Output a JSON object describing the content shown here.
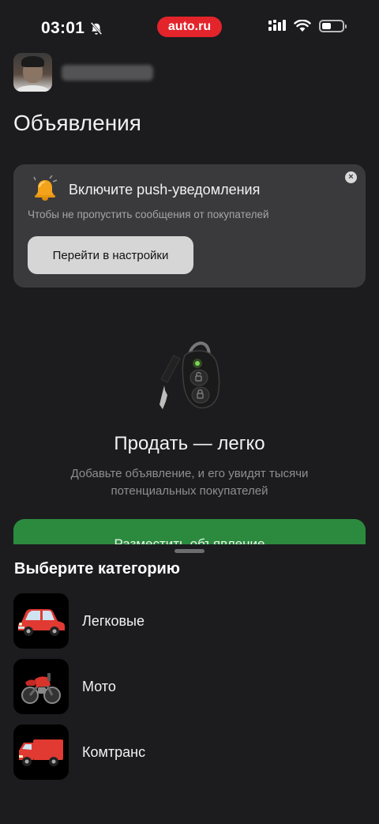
{
  "status_bar": {
    "time": "03:01",
    "brand": "auto.ru",
    "battery_level": 0.4
  },
  "icons": {
    "status": [
      "bell-slash-icon",
      "signal-icon",
      "wifi-icon",
      "battery-icon"
    ],
    "push": [
      "bell-icon",
      "close-icon"
    ]
  },
  "header": {
    "title": "Объявления"
  },
  "push_card": {
    "title": "Включите push-уведомления",
    "subtitle": "Чтобы не пропустить сообщения от покупателей",
    "button_label": "Перейти в настройки"
  },
  "empty_state": {
    "title": "Продать — легко",
    "description": "Добавьте объявление, и его увидят тысячи потенциальных покупателей",
    "button_label": "Разместить объявление"
  },
  "sheet": {
    "title": "Выберите категорию",
    "categories": [
      {
        "label": "Легковые",
        "icon": "car-icon"
      },
      {
        "label": "Мото",
        "icon": "motorcycle-icon"
      },
      {
        "label": "Комтранс",
        "icon": "truck-icon"
      }
    ]
  },
  "colors": {
    "brand": "#e3242b",
    "accent_green": "#2c8a3f",
    "background": "#1c1c1e",
    "card": "#3a3a3c"
  }
}
